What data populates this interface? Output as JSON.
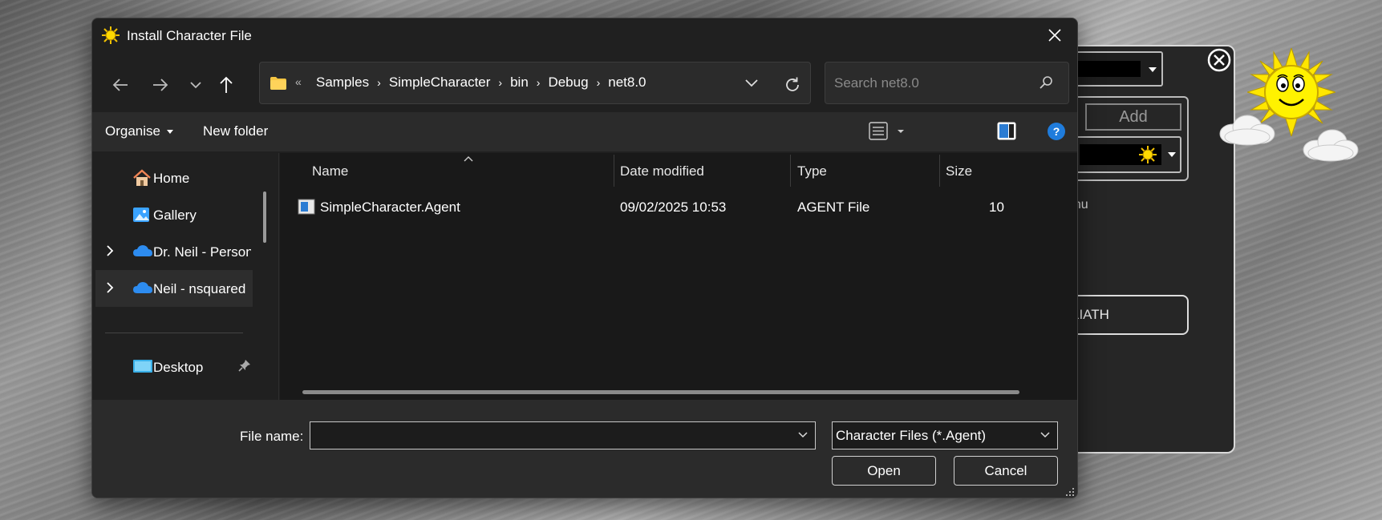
{
  "dialog": {
    "title": "Install Character File",
    "close_label": "Close"
  },
  "navigation": {
    "back_icon": "arrow-left-icon",
    "forward_icon": "arrow-right-icon",
    "recent_icon": "chevron-down-icon",
    "up_icon": "arrow-up-icon"
  },
  "address": {
    "overflow": "«",
    "crumbs": [
      "Samples",
      "SimpleCharacter",
      "bin",
      "Debug",
      "net8.0"
    ]
  },
  "search": {
    "placeholder": "Search net8.0"
  },
  "toolbar": {
    "organise": "Organise",
    "new_folder": "New folder"
  },
  "navpane": {
    "items": [
      {
        "label": "Home",
        "icon": "home-icon"
      },
      {
        "label": "Gallery",
        "icon": "gallery-icon"
      },
      {
        "label": "Dr. Neil - Personal",
        "icon": "onedrive-icon"
      },
      {
        "label": "Neil - nsquared",
        "icon": "onedrive-icon"
      },
      {
        "label": "Desktop",
        "icon": "desktop-icon"
      }
    ]
  },
  "columns": {
    "name": "Name",
    "date": "Date modified",
    "type": "Type",
    "size": "Size"
  },
  "files": [
    {
      "name": "SimpleCharacter.Agent",
      "date": "09/02/2025 10:53",
      "type": "AGENT File",
      "size": "10"
    }
  ],
  "bottom": {
    "file_name_label": "File name:",
    "file_name_value": "",
    "filter": "Character Files (*.Agent)",
    "open": "Open",
    "cancel": "Cancel"
  },
  "background_app": {
    "add": "Add",
    "menu_text": "enu",
    "button_text": "LIATH"
  }
}
